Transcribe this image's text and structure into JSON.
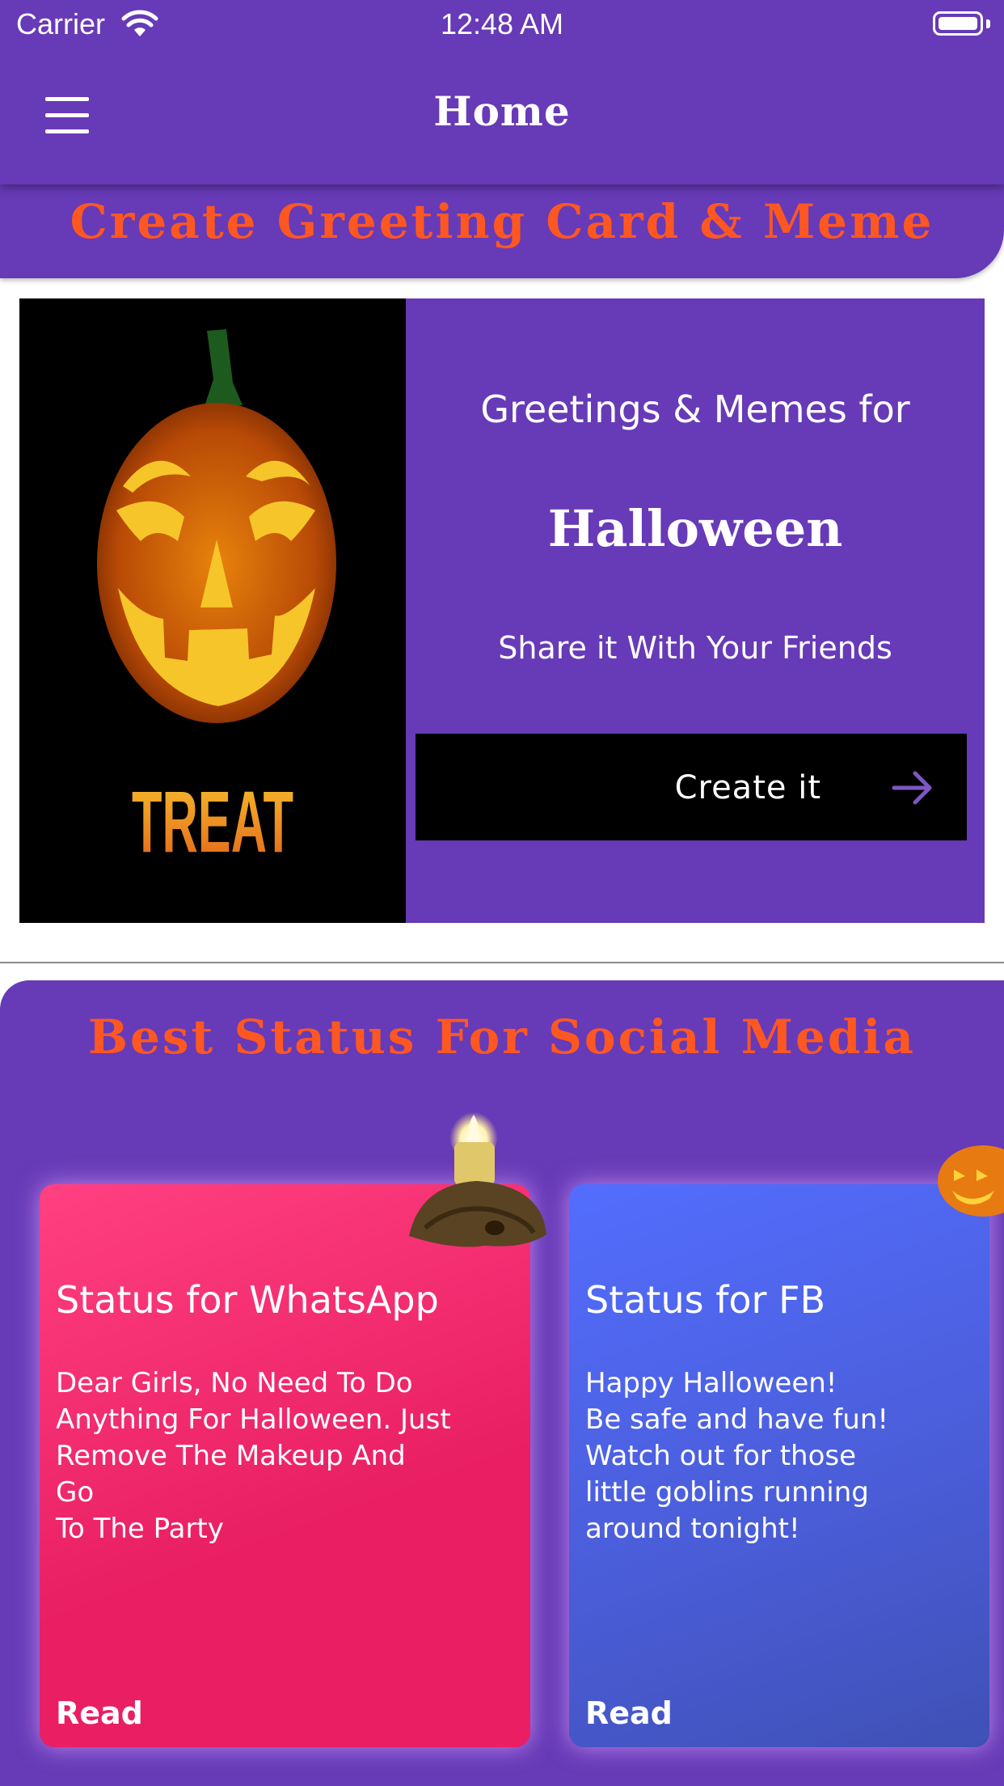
{
  "status_bar": {
    "carrier": "Carrier",
    "time": "12:48 AM"
  },
  "nav": {
    "title": "Home",
    "menu_icon": "hamburger-menu-icon"
  },
  "banner": {
    "title": "Create Greeting Card & Meme"
  },
  "promo": {
    "image_text": "TREAT",
    "line1": "Greetings & Memes for",
    "line2": "Halloween",
    "line3": "Share it With Your Friends",
    "button_label": "Create it",
    "button_icon": "arrow-right-icon"
  },
  "status_section": {
    "title": "Best Status For Social Media",
    "cards": [
      {
        "title": "Status for WhatsApp",
        "body": "Dear Girls, No Need To Do\nAnything For Halloween. Just\nRemove The Makeup And Go\nTo The Party",
        "read_label": "Read"
      },
      {
        "title": "Status for FB",
        "body": "Happy Halloween!\nBe safe and have fun!\nWatch out for those\nlittle goblins running\naround tonight!",
        "read_label": "Read"
      }
    ]
  },
  "colors": {
    "primary": "#673AB7",
    "accent": "#FF5722",
    "whatsapp_card": "#E91E63",
    "fb_card": "#3F51B5"
  }
}
